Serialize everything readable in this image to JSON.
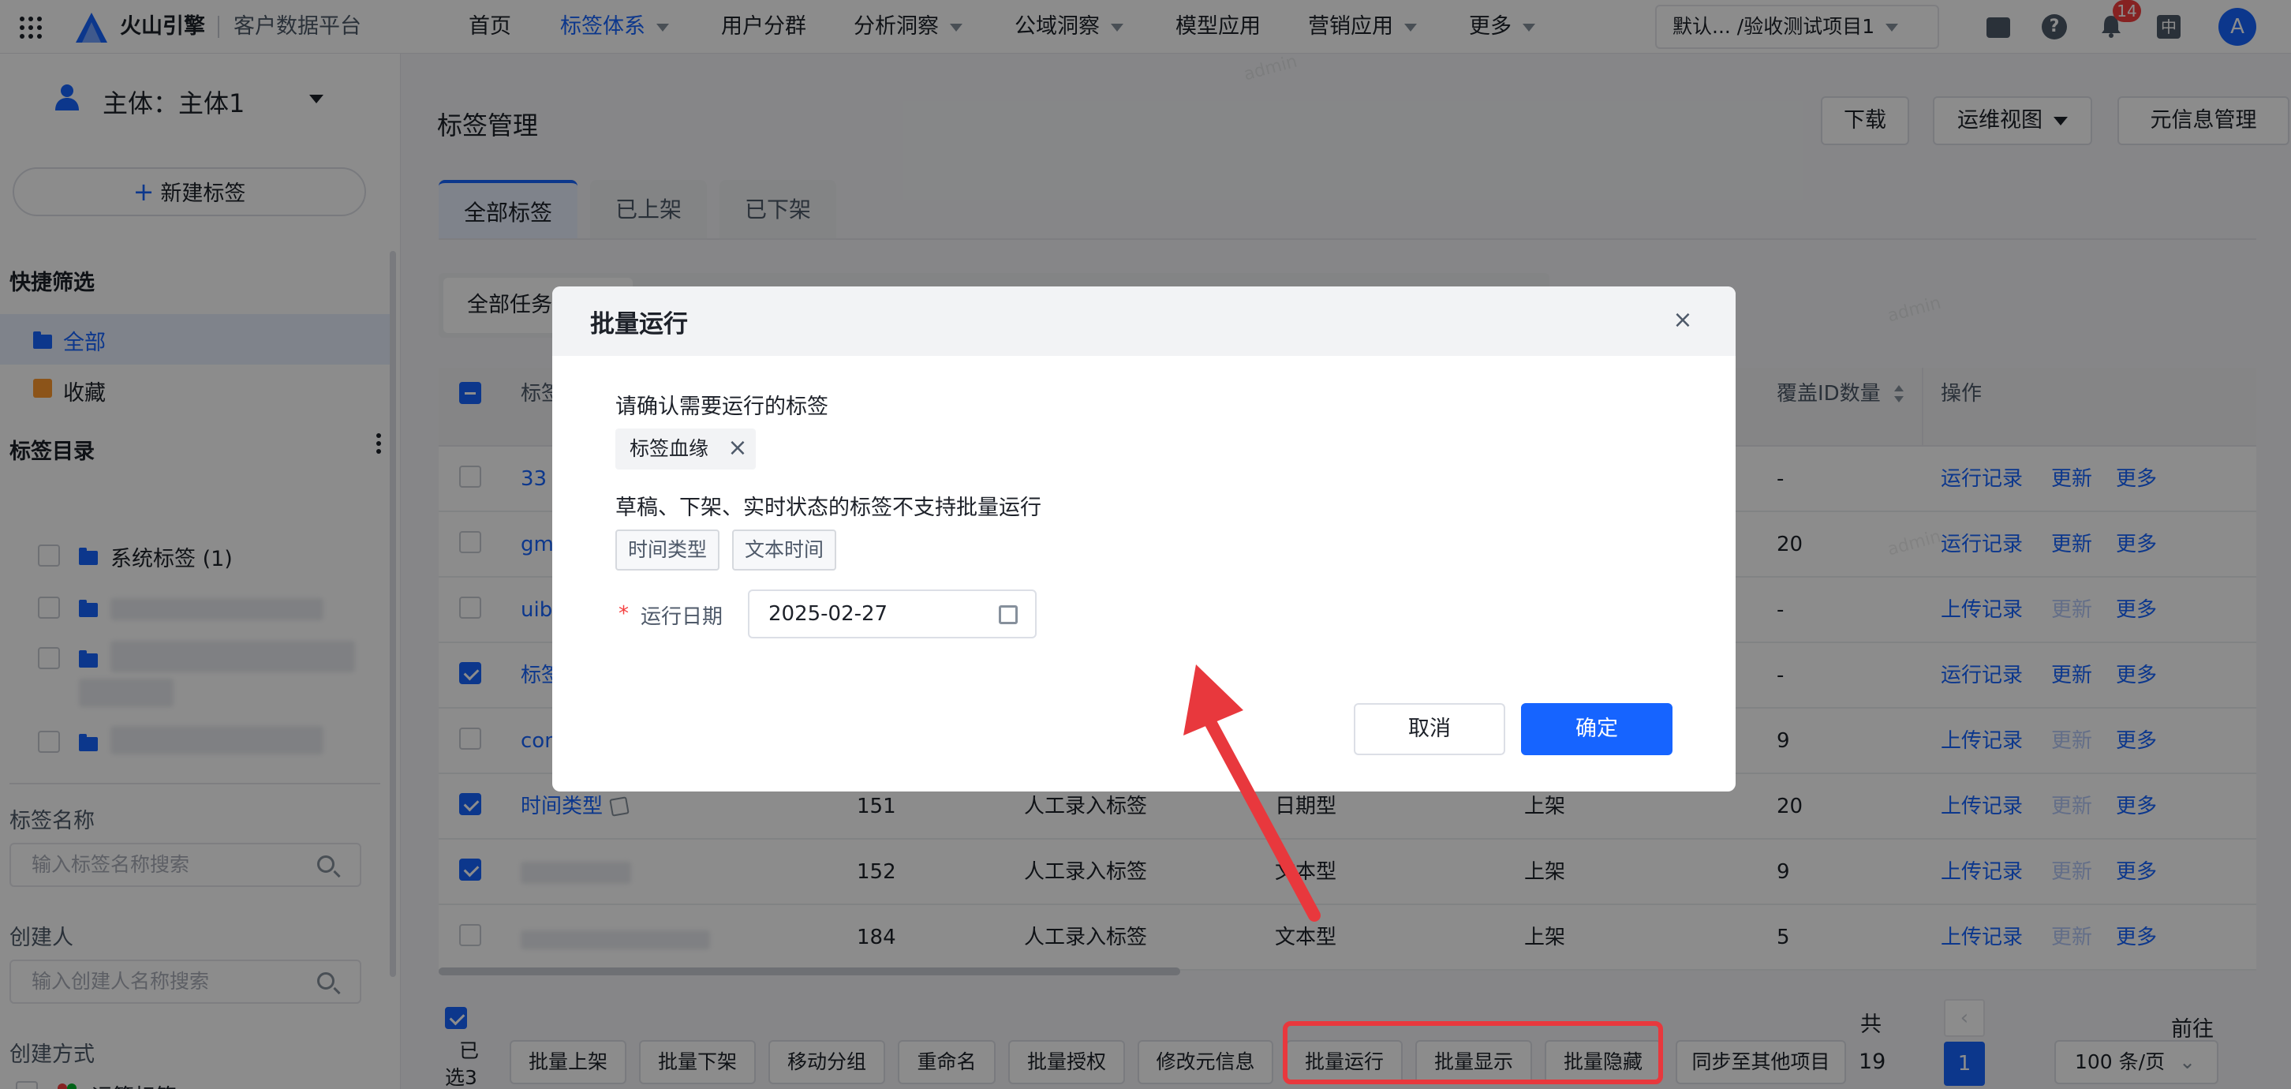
{
  "topnav": {
    "logo_text": "火山引擎",
    "product": "客户数据平台",
    "items": [
      {
        "label": "首页",
        "active": false,
        "dropdown": false
      },
      {
        "label": "标签体系",
        "active": true,
        "dropdown": true
      },
      {
        "label": "用户分群",
        "active": false,
        "dropdown": false
      },
      {
        "label": "分析洞察",
        "active": false,
        "dropdown": true
      },
      {
        "label": "公域洞察",
        "active": false,
        "dropdown": true
      },
      {
        "label": "模型应用",
        "active": false,
        "dropdown": false
      },
      {
        "label": "营销应用",
        "active": false,
        "dropdown": true
      },
      {
        "label": "更多",
        "active": false,
        "dropdown": true
      }
    ],
    "project_selector": "默认...   /验收测试项目1",
    "notification_count": "14",
    "lang": "中",
    "avatar": "A"
  },
  "sidebar": {
    "entity_label": "主体：主体1",
    "new_tag_button": "新建标签",
    "quick_filter_title": "快捷筛选",
    "quick_filters": [
      "全部",
      "收藏"
    ],
    "catalog_title": "标签目录",
    "catalog_items": [
      "系统标签 (1)"
    ],
    "tag_name_label": "标签名称",
    "tag_name_placeholder": "输入标签名称搜索",
    "creator_label": "创建人",
    "creator_placeholder": "输入创建人名称搜索",
    "create_method_label": "创建方式",
    "create_methods": [
      "运算标签"
    ]
  },
  "main": {
    "page_title": "标签管理",
    "header_buttons": {
      "download": "下载",
      "ops_view": "运维视图",
      "meta_manage": "元信息管理"
    },
    "tabs": [
      "全部标签",
      "已上架",
      "已下架"
    ],
    "task_filter": "全部任务",
    "columns": {
      "name": "标签",
      "coverage": "覆盖ID数量",
      "ops": "操作"
    },
    "rows": [
      {
        "name": "33",
        "id": "",
        "method": "",
        "type": "",
        "status": "",
        "coverage": "-",
        "action1": "运行记录",
        "action2": "更新",
        "action2_disabled": false,
        "action3": "更多",
        "checked": false
      },
      {
        "name": "gm",
        "id": "",
        "method": "",
        "type": "",
        "status": "",
        "coverage": "20",
        "action1": "运行记录",
        "action2": "更新",
        "action2_disabled": false,
        "action3": "更多",
        "checked": false
      },
      {
        "name": "uib",
        "id": "",
        "method": "",
        "type": "",
        "status": "",
        "coverage": "-",
        "action1": "上传记录",
        "action2": "更新",
        "action2_disabled": true,
        "action3": "更多",
        "checked": false
      },
      {
        "name": "标签",
        "id": "",
        "method": "",
        "type": "",
        "status": "",
        "coverage": "-",
        "action1": "运行记录",
        "action2": "更新",
        "action2_disabled": false,
        "action3": "更多",
        "checked": true
      },
      {
        "name": "con",
        "id": "",
        "method": "",
        "type": "",
        "status": "",
        "coverage": "9",
        "action1": "上传记录",
        "action2": "更新",
        "action2_disabled": true,
        "action3": "更多",
        "checked": false
      },
      {
        "name": "时间类型",
        "id": "151",
        "method": "人工录入标签",
        "type": "日期型",
        "status": "上架",
        "coverage": "20",
        "action1": "上传记录",
        "action2": "更新",
        "action2_disabled": true,
        "action3": "更多",
        "checked": true
      },
      {
        "name": "",
        "id": "152",
        "method": "人工录入标签",
        "type": "文本型",
        "status": "上架",
        "coverage": "9",
        "action1": "上传记录",
        "action2": "更新",
        "action2_disabled": true,
        "action3": "更多",
        "checked": true
      },
      {
        "name": "",
        "id": "184",
        "method": "人工录入标签",
        "type": "文本型",
        "status": "上架",
        "coverage": "5",
        "action1": "上传记录",
        "action2": "更新",
        "action2_disabled": true,
        "action3": "更多",
        "checked": false
      }
    ],
    "footer": {
      "selected_text_1": "已",
      "selected_text_2": "选3",
      "batch_buttons": [
        "批量上架",
        "批量下架",
        "移动分组",
        "重命名",
        "批量授权",
        "修改元信息",
        "批量运行",
        "批量显示",
        "批量隐藏",
        "同步至其他项目"
      ],
      "total_label": "共",
      "total_count": "19",
      "page": "1",
      "page_size": "100 条/页",
      "goto": "前往"
    }
  },
  "modal": {
    "title": "批量运行",
    "confirm_prompt": "请确认需要运行的标签",
    "selected_tags": [
      "标签血缘"
    ],
    "unsupported_text": "草稿、下架、实时状态的标签不支持批量运行",
    "unsupported_tags": [
      "时间类型",
      "文本时间"
    ],
    "run_date_label": "运行日期",
    "run_date_value": "2025-02-27",
    "cancel": "取消",
    "ok": "确定"
  },
  "watermark": "admin",
  "colors": {
    "accent": "#1664ff",
    "annotation": "#e8383d"
  }
}
